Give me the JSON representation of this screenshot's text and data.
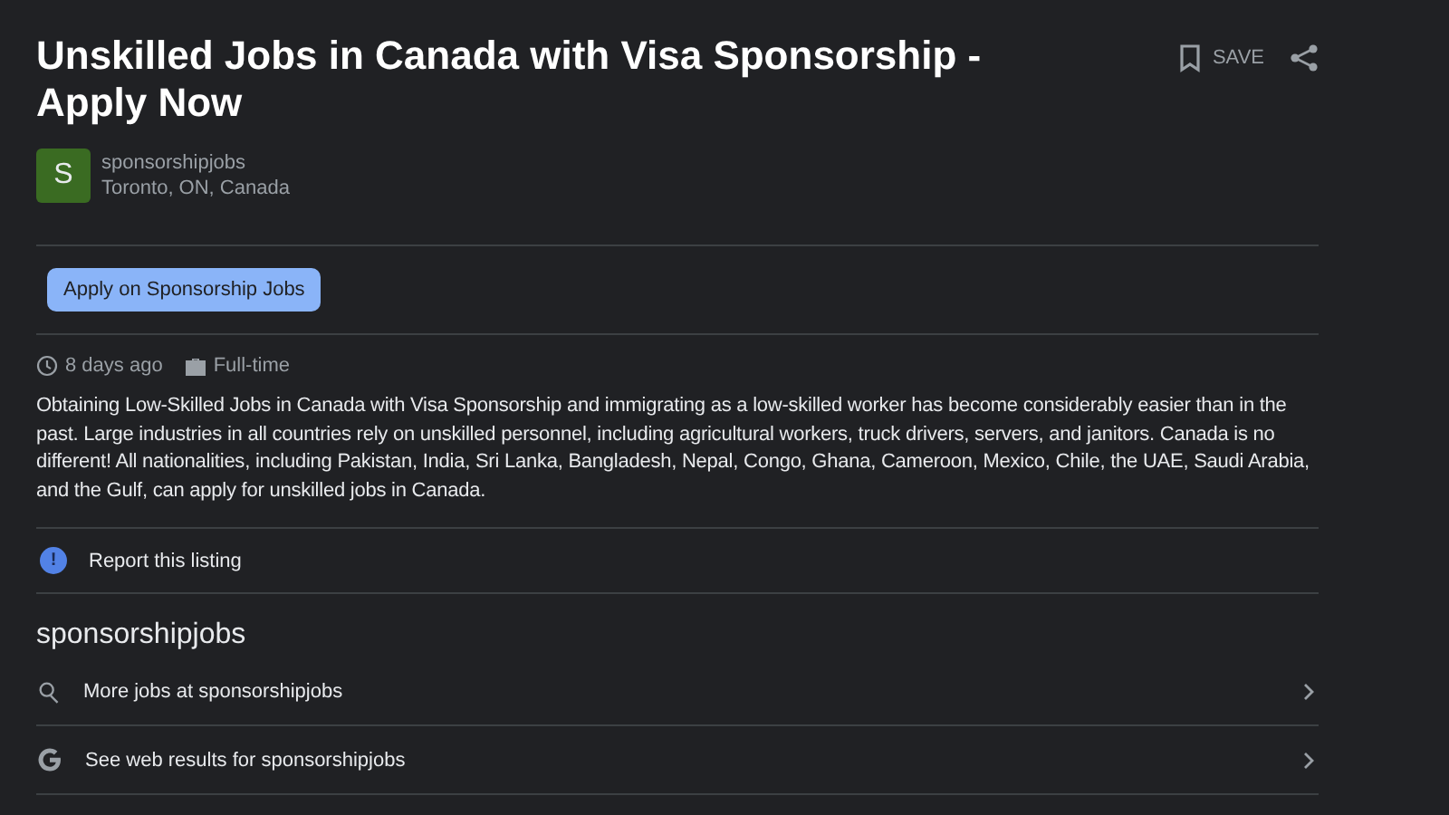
{
  "job": {
    "title": "Unskilled Jobs in Canada with Visa Sponsorship - Apply Now",
    "save_label": "SAVE",
    "avatar_letter": "S",
    "employer": "sponsorshipjobs",
    "location": "Toronto, ON, Canada"
  },
  "apply_button": "Apply on Sponsorship Jobs",
  "meta": {
    "posted": "8 days ago",
    "type": "Full-time"
  },
  "description": "Obtaining Low-Skilled Jobs in Canada with Visa Sponsorship and immigrating as a low-skilled worker has become considerably easier than in the past. Large industries in all countries rely on unskilled personnel, including agricultural workers, truck drivers, servers, and janitors. Canada is no different! All nationalities, including Pakistan, India, Sri Lanka, Bangladesh, Nepal, Congo, Ghana, Cameroon, Mexico, Chile, the UAE, Saudi Arabia, and the Gulf, can apply for unskilled jobs in Canada.",
  "report": {
    "icon": "!",
    "label": "Report this listing"
  },
  "employer_section": {
    "heading": "sponsorshipjobs",
    "links": [
      {
        "kind": "search",
        "label": "More jobs at sponsorshipjobs"
      },
      {
        "kind": "google",
        "label": "See web results for sponsorshipjobs"
      }
    ]
  }
}
